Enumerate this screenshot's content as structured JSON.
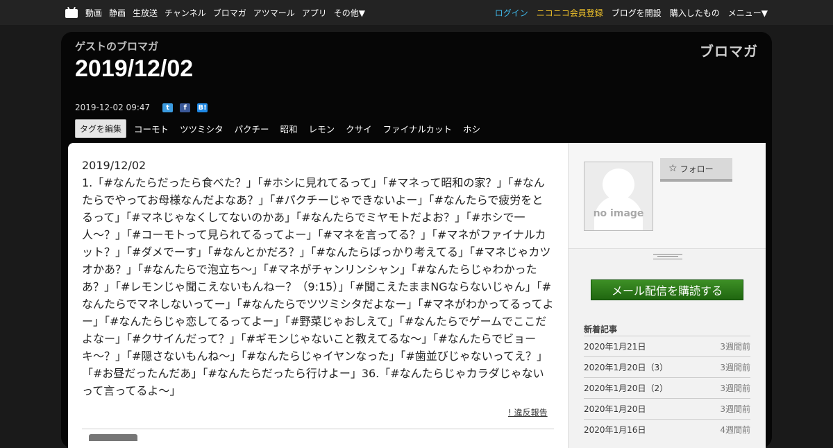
{
  "nav": {
    "left": [
      "動画",
      "静画",
      "生放送",
      "チャンネル",
      "ブロマガ",
      "アツマール",
      "アプリ",
      "その他▼"
    ],
    "login": "ログイン",
    "register": "ニコニコ会員登録",
    "open_blog": "ブログを開設",
    "purchased": "購入したもの",
    "menu": "メニュー▼"
  },
  "header": {
    "blog_name": "ゲストのブロマガ",
    "title": "2019/12/02",
    "logo": "ブロマガ",
    "datetime": "2019-12-02 09:47",
    "share_icons": [
      "twitter-icon",
      "facebook-icon",
      "hatena-bookmark-icon"
    ]
  },
  "tags": {
    "edit_label": "タグを編集",
    "items": [
      "コーモト",
      "ツツミシタ",
      "パクチー",
      "昭和",
      "レモン",
      "クサイ",
      "ファイナルカット",
      "ホシ"
    ]
  },
  "article": {
    "date_line": "2019/12/02",
    "body": "1.「#なんたらだったら食べた？」「#ホシに見れてるって」「#マネって昭和の家？」「#なんたらでやってお母様なんだよなあ？」「#パクチーじゃできないよー」「#なんたらで疲労をとるって」「#マネじゃなくしてないのかあ」「#なんたらでミヤモトだよお？」「#ホシで一人〜？」「#コーモトって見られてるってよー」「#マネを言ってる？」「#マネがファイナルカット？」「#ダメでーす」「#なんとかだろ？」「#なんたらばっかり考えてる」「#マネじゃカツオかあ？」「#なんたらで泡立ち〜」「#マネがチャンリンシャン」「#なんたらじゃわかったあ？」「#レモンじゃ聞こえないもんねー？（9:15）」「#聞こえたままNGならないじゃん」「#なんたらでマネしないってー」「#なんたらでツツミシタだよなー」「#マネがわかってるってよー」「#なんたらじゃ恋してるってよー」「#野菜じゃおしえて」「#なんたらでゲームでここだよなー」「#クサイんだって？」「#ギモンじゃないこと教えてるな〜」「#なんたらでビョーキ〜？」「#隠さないもんね〜」「#なんたらじゃイヤンなった」「#歯並びじゃないってえ？」「#お昼だったんだあ」「#なんたらだったら行けよー」36.「#なんたらじゃカラダじゃないって言ってるよ〜」",
    "report": "! 違反報告"
  },
  "sidebar": {
    "no_image": "no image",
    "follow": "フォロー",
    "subscribe": "メール配信を購読する",
    "recent_heading": "新着記事",
    "recent": [
      {
        "title": "2020年1月21日",
        "when": "3週間前"
      },
      {
        "title": "2020年1月20日（3）",
        "when": "3週間前"
      },
      {
        "title": "2020年1月20日（2）",
        "when": "3週間前"
      },
      {
        "title": "2020年1月20日",
        "when": "3週間前"
      },
      {
        "title": "2020年1月16日",
        "when": "4週間前"
      }
    ]
  }
}
